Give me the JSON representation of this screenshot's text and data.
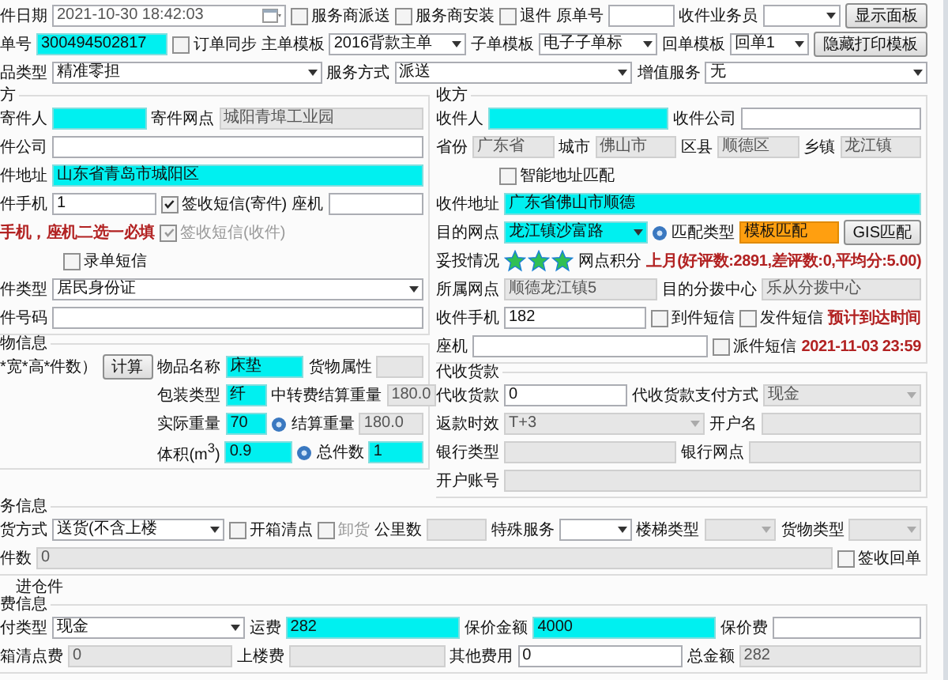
{
  "top_rows": [
    {
      "items": [
        {
          "kind": "label",
          "text": "件日期"
        },
        {
          "kind": "date",
          "value": "2021-10-30 18:42:03",
          "required": false,
          "readonly": false,
          "matched": false
        },
        {
          "kind": "check",
          "label": "服务商派送",
          "checked": false,
          "disabled": false
        },
        {
          "kind": "check",
          "label": "服务商安装",
          "checked": false,
          "disabled": false
        },
        {
          "kind": "check",
          "label": "退件",
          "checked": false,
          "disabled": false
        },
        {
          "kind": "label",
          "text": "原单号"
        },
        {
          "kind": "field",
          "required": false,
          "readonly": false,
          "matched": false
        },
        {
          "kind": "label",
          "text": "收件业务员"
        },
        {
          "kind": "select",
          "required": false,
          "readonly": false,
          "matched": false
        },
        {
          "kind": "button",
          "label": "显示面板"
        }
      ]
    },
    {
      "items": [
        {
          "kind": "label",
          "text": "单号"
        },
        {
          "kind": "field",
          "value": "300494502817",
          "required": true,
          "readonly": false,
          "matched": false
        },
        {
          "kind": "check",
          "label": "订单同步",
          "checked": false,
          "disabled": false
        },
        {
          "kind": "label",
          "text": "主单模板"
        },
        {
          "kind": "select",
          "value": "2016背款主单",
          "required": false,
          "readonly": false,
          "matched": false
        },
        {
          "kind": "label",
          "text": "子单模板"
        },
        {
          "kind": "select",
          "value": "电子子单标",
          "required": false,
          "readonly": false,
          "matched": false
        },
        {
          "kind": "label",
          "text": "回单模板"
        },
        {
          "kind": "select",
          "value": "回单1",
          "required": false,
          "readonly": false,
          "matched": false
        },
        {
          "kind": "button",
          "label": "隐藏打印模板"
        }
      ]
    },
    {
      "items": [
        {
          "kind": "label",
          "text": "品类型"
        },
        {
          "kind": "select",
          "value": "精准零担",
          "required": false,
          "readonly": false,
          "matched": false
        },
        {
          "kind": "label",
          "text": "服务方式"
        },
        {
          "kind": "select",
          "value": "派送",
          "required": false,
          "readonly": false,
          "matched": false
        },
        {
          "kind": "label",
          "text": "增值服务"
        },
        {
          "kind": "select",
          "value": "无",
          "required": false,
          "readonly": false,
          "matched": false
        }
      ]
    }
  ],
  "sender": {
    "title": "方",
    "rows": [
      {
        "items": [
          {
            "kind": "label",
            "text": "寄件人"
          },
          {
            "kind": "field",
            "required": true,
            "readonly": false,
            "matched": false
          },
          {
            "kind": "label",
            "text": "寄件网点"
          },
          {
            "kind": "field",
            "value": "城阳青埠工业园",
            "required": false,
            "readonly": true,
            "matched": false
          }
        ]
      },
      {
        "items": [
          {
            "kind": "label",
            "text": "件公司"
          },
          {
            "kind": "field",
            "required": false,
            "readonly": false,
            "matched": false
          }
        ]
      },
      {
        "items": [
          {
            "kind": "label",
            "text": "件地址"
          },
          {
            "kind": "field",
            "value": "山东省青岛市城阳区",
            "required": true,
            "readonly": false,
            "matched": false
          }
        ]
      },
      {
        "items": [
          {
            "kind": "label",
            "text": "件手机"
          },
          {
            "kind": "field",
            "value": "1",
            "required": false,
            "readonly": false,
            "matched": false
          },
          {
            "kind": "check",
            "label": "签收短信(寄件)",
            "checked": true,
            "disabled": false
          },
          {
            "kind": "label",
            "text": "座机"
          },
          {
            "kind": "field",
            "required": false,
            "readonly": false,
            "matched": false
          }
        ]
      },
      {
        "items": [
          {
            "kind": "note",
            "text": "手机，座机二选一必填"
          },
          {
            "kind": "check",
            "label": "签收短信(收件)",
            "checked": true,
            "disabled": true
          }
        ]
      },
      {
        "items": [
          {
            "kind": "check",
            "label": "录单短信",
            "checked": false,
            "disabled": false
          }
        ]
      },
      {
        "items": [
          {
            "kind": "label",
            "text": "件类型"
          },
          {
            "kind": "select",
            "value": "居民身份证",
            "required": false,
            "readonly": false,
            "matched": false
          }
        ]
      },
      {
        "items": [
          {
            "kind": "label",
            "text": "件号码"
          },
          {
            "kind": "field",
            "required": false,
            "readonly": false,
            "matched": false
          }
        ]
      }
    ]
  },
  "goods": {
    "title": "物信息",
    "side": {
      "items": [
        {
          "kind": "label",
          "text": "*宽*高*件数）"
        },
        {
          "kind": "button",
          "label": "计算"
        }
      ]
    },
    "rows": [
      {
        "items": [
          {
            "kind": "label",
            "text": "物品名称"
          },
          {
            "kind": "field",
            "value": "床垫",
            "required": true,
            "readonly": false,
            "matched": false
          },
          {
            "kind": "label",
            "text": "货物属性"
          },
          {
            "kind": "field",
            "required": false,
            "readonly": true,
            "matched": false
          }
        ]
      },
      {
        "items": [
          {
            "kind": "label",
            "text": "包装类型"
          },
          {
            "kind": "field",
            "value": "纤",
            "required": true,
            "readonly": false,
            "matched": false
          },
          {
            "kind": "label",
            "text": "中转费结算重量"
          },
          {
            "kind": "field",
            "value": "180.0",
            "required": false,
            "readonly": true,
            "matched": false
          }
        ]
      },
      {
        "items": [
          {
            "kind": "label",
            "text": "实际重量"
          },
          {
            "kind": "field",
            "value": "70",
            "required": true,
            "readonly": false,
            "matched": false
          },
          {
            "kind": "info"
          },
          {
            "kind": "label",
            "text": "结算重量"
          },
          {
            "kind": "field",
            "value": "180.0",
            "required": false,
            "readonly": true,
            "matched": false
          }
        ]
      },
      {
        "items": [
          {
            "kind": "label",
            "text": "体积(m$^{3}$)"
          },
          {
            "kind": "field",
            "value": "0.9",
            "required": true,
            "readonly": false,
            "matched": false
          },
          {
            "kind": "info"
          },
          {
            "kind": "label",
            "text": "总件数"
          },
          {
            "kind": "field",
            "value": "1",
            "required": true,
            "readonly": false,
            "matched": false
          }
        ]
      }
    ]
  },
  "receiver": {
    "title": "收方",
    "rows": [
      {
        "items": [
          {
            "kind": "label",
            "text": "收件人"
          },
          {
            "kind": "field",
            "required": true,
            "readonly": false,
            "matched": false
          },
          {
            "kind": "label",
            "text": "收件公司"
          },
          {
            "kind": "field",
            "required": false,
            "readonly": false,
            "matched": false
          }
        ]
      },
      {
        "items": [
          {
            "kind": "label",
            "text": "省份"
          },
          {
            "kind": "field",
            "value": "广东省",
            "required": false,
            "readonly": true,
            "matched": false
          },
          {
            "kind": "label",
            "text": "城市"
          },
          {
            "kind": "field",
            "value": "佛山市",
            "required": false,
            "readonly": true,
            "matched": false
          },
          {
            "kind": "label",
            "text": "区县"
          },
          {
            "kind": "field",
            "value": "顺德区",
            "required": false,
            "readonly": true,
            "matched": false
          },
          {
            "kind": "label",
            "text": "乡镇"
          },
          {
            "kind": "field",
            "value": "龙江镇",
            "required": false,
            "readonly": true,
            "matched": false
          }
        ]
      },
      {
        "items": [
          {
            "kind": "check",
            "label": "智能地址匹配",
            "checked": false,
            "disabled": false
          }
        ]
      },
      {
        "items": [
          {
            "kind": "label",
            "text": "收件地址"
          },
          {
            "kind": "field",
            "value": "广东省佛山市顺德",
            "required": true,
            "readonly": false,
            "matched": false
          }
        ]
      },
      {
        "items": [
          {
            "kind": "label",
            "text": "目的网点"
          },
          {
            "kind": "select",
            "value": "龙江镇沙富路",
            "required": true,
            "readonly": false,
            "matched": false
          },
          {
            "kind": "info"
          },
          {
            "kind": "label",
            "text": "匹配类型"
          },
          {
            "kind": "field",
            "value": "模板匹配",
            "required": false,
            "readonly": false,
            "matched": true
          },
          {
            "kind": "button",
            "label": "GIS匹配"
          }
        ]
      },
      {
        "items": [
          {
            "kind": "label",
            "text": "妥投情况"
          },
          {
            "kind": "stars",
            "stars": 3
          },
          {
            "kind": "label",
            "text": "网点积分"
          },
          {
            "kind": "note",
            "text": "上月(好评数:2891,差评数:0,平均分:5.00)"
          }
        ]
      },
      {
        "items": [
          {
            "kind": "label",
            "text": "所属网点"
          },
          {
            "kind": "field",
            "value": "顺德龙江镇5",
            "required": false,
            "readonly": true,
            "matched": false
          },
          {
            "kind": "label",
            "text": "目的分拨中心"
          },
          {
            "kind": "field",
            "value": "乐从分拨中心",
            "required": false,
            "readonly": true,
            "matched": false
          }
        ]
      },
      {
        "items": [
          {
            "kind": "label",
            "text": "收件手机"
          },
          {
            "kind": "field",
            "value": "182",
            "required": false,
            "readonly": false,
            "matched": false
          },
          {
            "kind": "check",
            "label": "到件短信",
            "checked": false,
            "disabled": false
          },
          {
            "kind": "check",
            "label": "发件短信",
            "checked": false,
            "disabled": false
          },
          {
            "kind": "note",
            "text": "预计到达时间"
          }
        ]
      },
      {
        "items": [
          {
            "kind": "label",
            "text": "座机"
          },
          {
            "kind": "field",
            "required": false,
            "readonly": false,
            "matched": false
          },
          {
            "kind": "check",
            "label": "派件短信",
            "checked": false,
            "disabled": false
          },
          {
            "kind": "note",
            "text": "2021-11-03 23:59"
          }
        ]
      }
    ]
  },
  "cod": {
    "title": "代收货款",
    "rows": [
      {
        "items": [
          {
            "kind": "label",
            "text": "代收货款"
          },
          {
            "kind": "field",
            "value": "0",
            "required": false,
            "readonly": false,
            "matched": false
          },
          {
            "kind": "label",
            "text": "代收货款支付方式"
          },
          {
            "kind": "select",
            "value": "现金",
            "required": false,
            "readonly": true,
            "matched": false
          }
        ]
      },
      {
        "items": [
          {
            "kind": "label",
            "text": "返款时效"
          },
          {
            "kind": "select",
            "value": "T+3",
            "required": false,
            "readonly": true,
            "matched": false
          },
          {
            "kind": "label",
            "text": "开户名"
          },
          {
            "kind": "field",
            "required": false,
            "readonly": true,
            "matched": false
          }
        ]
      },
      {
        "items": [
          {
            "kind": "label",
            "text": "银行类型"
          },
          {
            "kind": "field",
            "required": false,
            "readonly": true,
            "matched": false
          },
          {
            "kind": "label",
            "text": "银行网点"
          },
          {
            "kind": "field",
            "required": false,
            "readonly": true,
            "matched": false
          }
        ]
      },
      {
        "items": [
          {
            "kind": "label",
            "text": "开户账号"
          },
          {
            "kind": "field",
            "required": false,
            "readonly": true,
            "matched": false
          }
        ]
      }
    ]
  },
  "service": {
    "title": "务信息",
    "rows": [
      {
        "items": [
          {
            "kind": "label",
            "text": "货方式"
          },
          {
            "kind": "select",
            "value": "送货(不含上楼",
            "required": false,
            "readonly": false,
            "matched": false
          },
          {
            "kind": "check",
            "label": "开箱清点",
            "checked": false,
            "disabled": false
          },
          {
            "kind": "check",
            "label": "卸货",
            "checked": false,
            "disabled": true
          },
          {
            "kind": "label",
            "text": "公里数"
          },
          {
            "kind": "field",
            "required": false,
            "readonly": true,
            "matched": false
          },
          {
            "kind": "label",
            "text": "特殊服务"
          },
          {
            "kind": "select",
            "required": false,
            "readonly": false,
            "matched": false
          },
          {
            "kind": "label",
            "text": "楼梯类型"
          },
          {
            "kind": "select",
            "required": false,
            "readonly": true,
            "matched": false
          },
          {
            "kind": "label",
            "text": "货物类型"
          },
          {
            "kind": "select",
            "required": false,
            "readonly": true,
            "matched": false
          }
        ]
      },
      {
        "items": [
          {
            "kind": "label",
            "text": "件数"
          },
          {
            "kind": "field",
            "value": "0",
            "required": false,
            "readonly": true,
            "matched": false
          },
          {
            "kind": "check",
            "label": "签收回单",
            "checked": false,
            "disabled": false
          }
        ]
      }
    ]
  },
  "warehouse": {
    "label": "进仓件"
  },
  "fees": {
    "title": "费信息",
    "rows": [
      {
        "items": [
          {
            "kind": "label",
            "text": "付类型"
          },
          {
            "kind": "select",
            "value": "现金",
            "required": false,
            "readonly": false,
            "matched": false
          },
          {
            "kind": "label",
            "text": "运费"
          },
          {
            "kind": "field",
            "value": "282",
            "required": true,
            "readonly": false,
            "matched": false
          },
          {
            "kind": "label",
            "text": "保价金额"
          },
          {
            "kind": "field",
            "value": "4000",
            "required": true,
            "readonly": false,
            "matched": false
          },
          {
            "kind": "label",
            "text": "保价费"
          },
          {
            "kind": "field",
            "required": false,
            "readonly": false,
            "matched": false
          }
        ]
      },
      {
        "items": [
          {
            "kind": "label",
            "text": "箱清点费"
          },
          {
            "kind": "field",
            "value": "0",
            "required": false,
            "readonly": true,
            "matched": false
          },
          {
            "kind": "label",
            "text": "上楼费"
          },
          {
            "kind": "field",
            "required": false,
            "readonly": true,
            "matched": false
          },
          {
            "kind": "label",
            "text": "其他费用"
          },
          {
            "kind": "field",
            "value": "0",
            "required": false,
            "readonly": false,
            "matched": false
          },
          {
            "kind": "label",
            "text": "总金额"
          },
          {
            "kind": "field",
            "value": "282",
            "required": false,
            "readonly": true,
            "matched": false
          }
        ]
      }
    ]
  }
}
